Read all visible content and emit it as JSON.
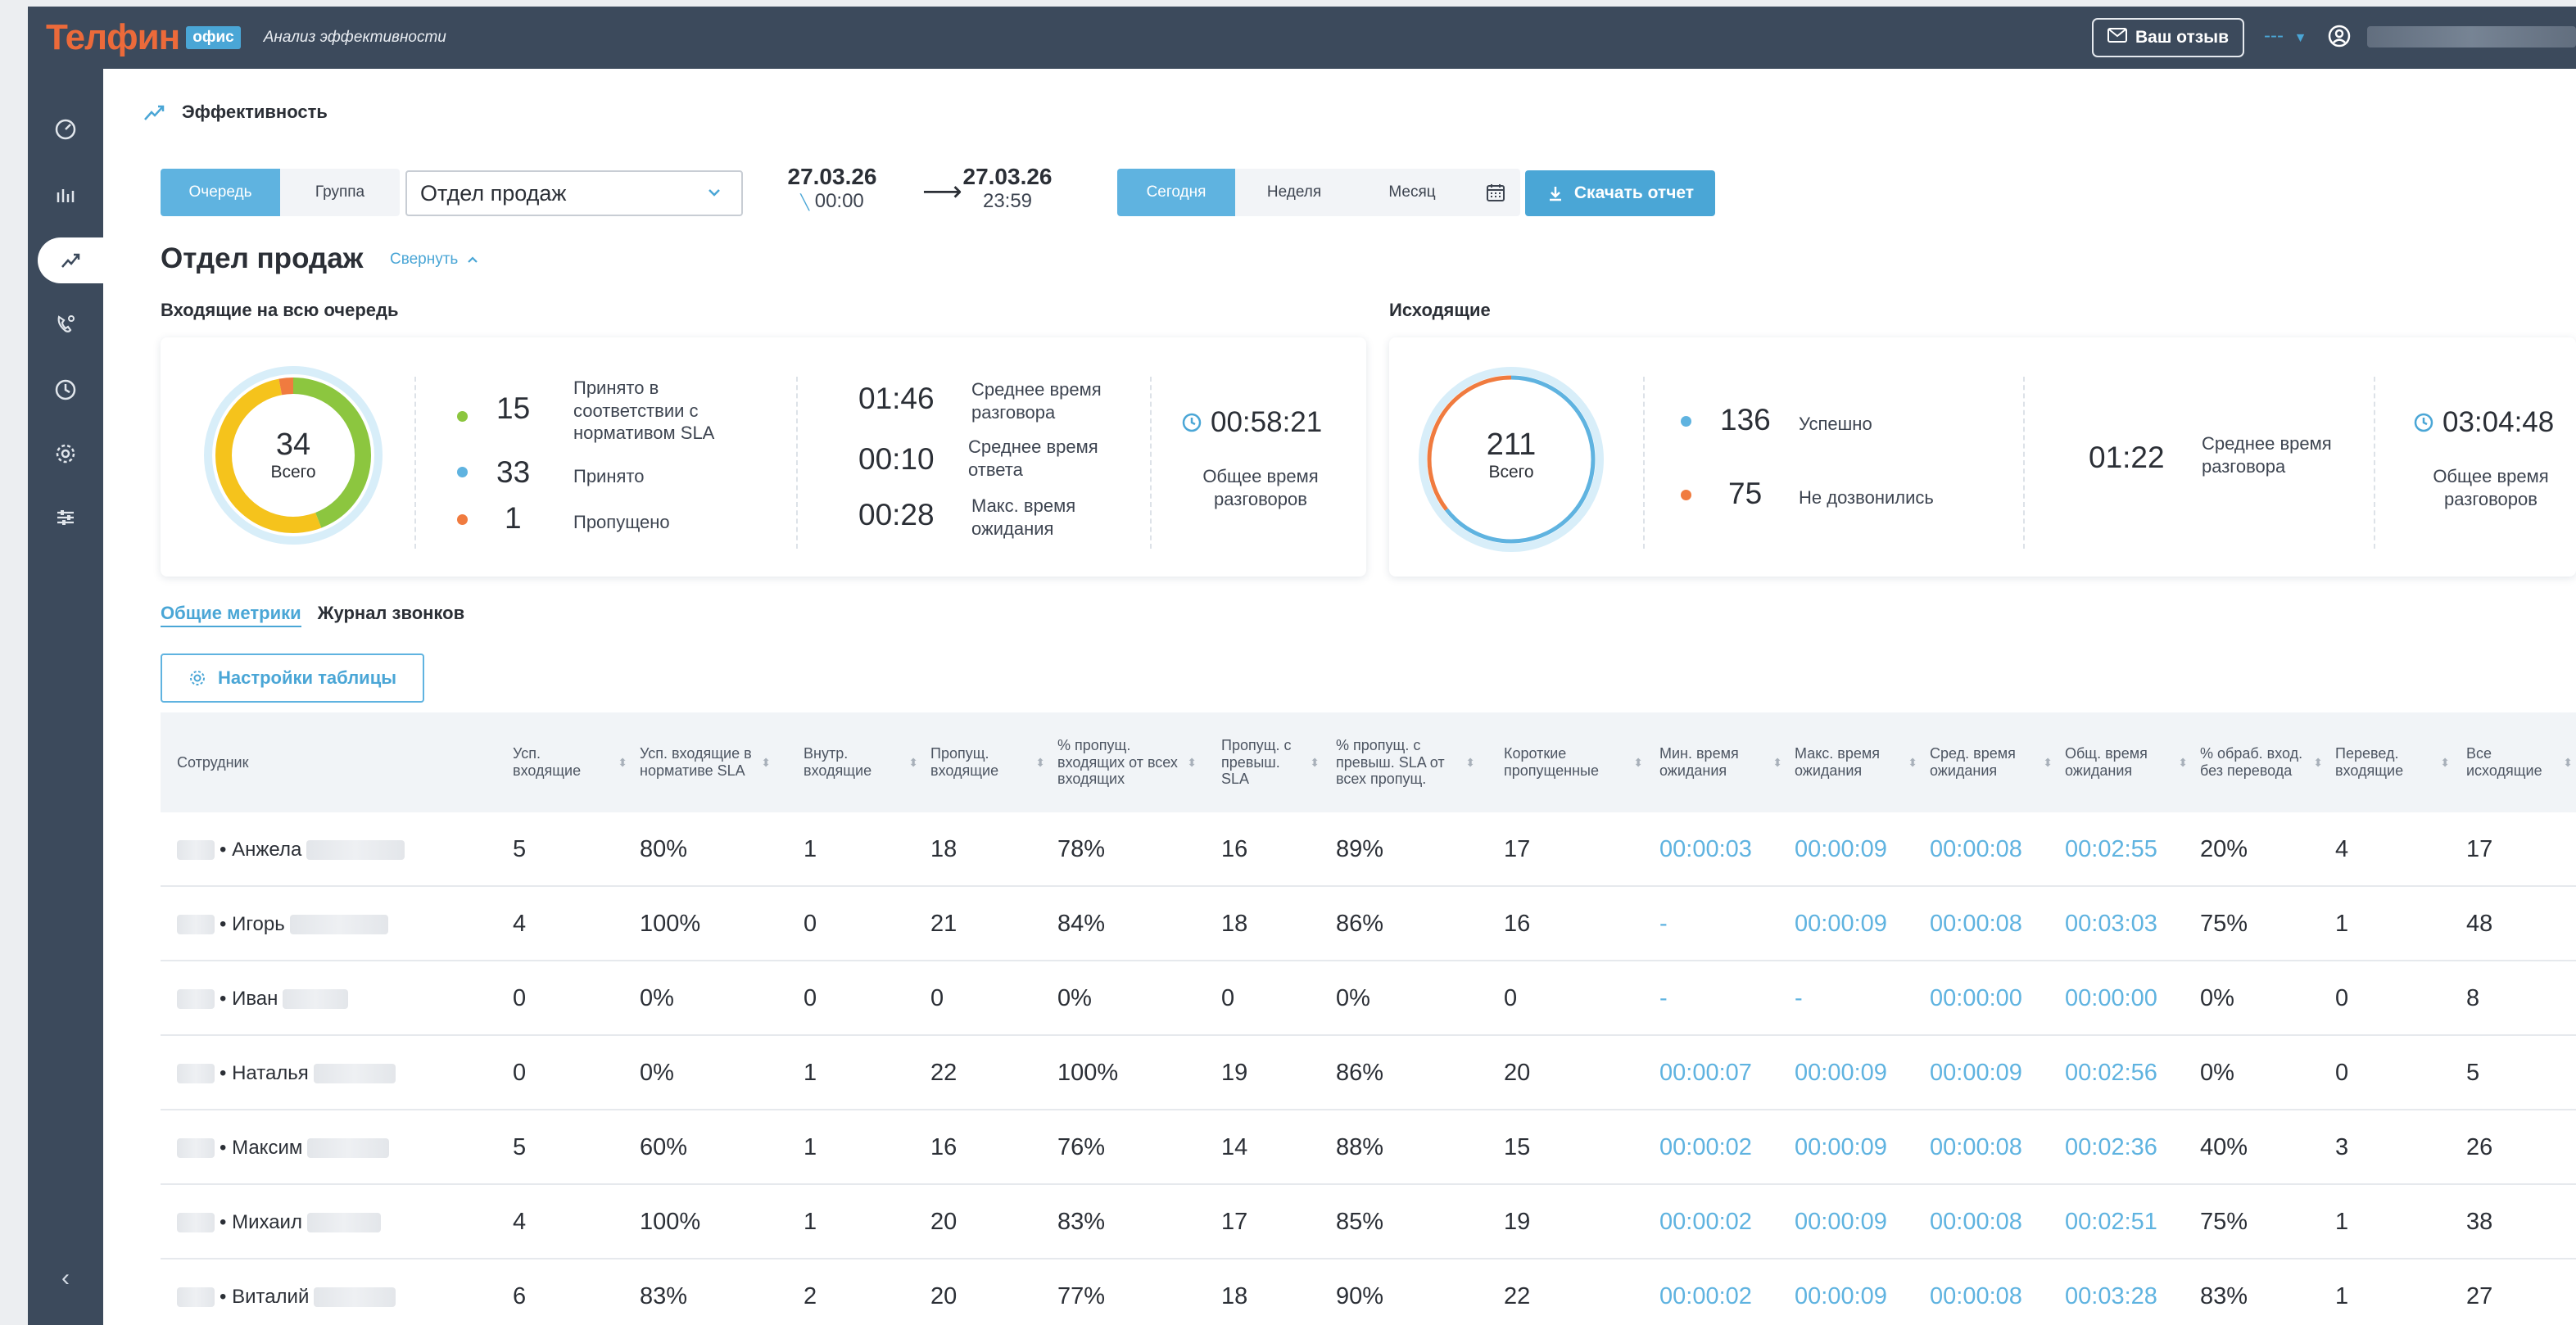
{
  "header": {
    "logo_main": "Телфин",
    "logo_badge": "офис",
    "subtitle": "Анализ эффективности",
    "feedback_label": "Ваш отзыв",
    "account_dash": "---"
  },
  "sidebar": {
    "items": [
      {
        "icon": "dashboard-gauge-icon"
      },
      {
        "icon": "bar-chart-icon"
      },
      {
        "icon": "trend-icon",
        "active": true
      },
      {
        "icon": "phone-settings-icon"
      },
      {
        "icon": "clock-icon"
      },
      {
        "icon": "gear-icon"
      },
      {
        "icon": "sliders-icon"
      }
    ],
    "collapse_glyph": "‹"
  },
  "section": {
    "title": "Эффективность"
  },
  "filters": {
    "mode_tabs": [
      {
        "label": "Очередь",
        "active": true
      },
      {
        "label": "Группа",
        "active": false
      }
    ],
    "department": "Отдел продаж",
    "date_from": "27.03.26",
    "time_from": "00:00",
    "date_to": "27.03.26",
    "time_to": "23:59",
    "period_tabs": [
      {
        "label": "Сегодня",
        "active": true
      },
      {
        "label": "Неделя",
        "active": false
      },
      {
        "label": "Месяц",
        "active": false
      }
    ],
    "download_label": "Скачать отчет"
  },
  "page": {
    "title": "Отдел продаж",
    "collapse_label": "Свернуть"
  },
  "incoming": {
    "label": "Входящие на всю очередь",
    "total": "34",
    "total_label": "Всего",
    "donut_fraction": {
      "sla": 0.441,
      "accepted_other": 0.529,
      "missed": 0.03
    },
    "stats": [
      {
        "value": "15",
        "label": "Принято в соответствии с нормативом SLA",
        "color": "#8cc63f"
      },
      {
        "value": "33",
        "label": "Принято",
        "color": "#5fb3e0"
      },
      {
        "value": "1",
        "label": "Пропущено",
        "color": "#f07b3f"
      }
    ],
    "times": [
      {
        "value": "01:46",
        "label": "Среднее время разговора"
      },
      {
        "value": "00:10",
        "label": "Среднее время ответа"
      },
      {
        "value": "00:28",
        "label": "Макс. время ожидания"
      }
    ],
    "total_talk": "00:58:21",
    "total_talk_label": "Общее время разговоров"
  },
  "outgoing": {
    "label": "Исходящие",
    "total": "211",
    "total_label": "Всего",
    "donut_fraction": {
      "success": 0.645,
      "failed": 0.355
    },
    "stats": [
      {
        "value": "136",
        "label": "Успешно",
        "color": "#5fb3e0"
      },
      {
        "value": "75",
        "label": "Не дозвонились",
        "color": "#f07b3f"
      }
    ],
    "avg_talk": "01:22",
    "avg_talk_label": "Среднее время разговора",
    "total_talk": "03:04:48",
    "total_talk_label": "Общее время разговоров"
  },
  "tabs": [
    {
      "label": "Общие метрики",
      "active": true
    },
    {
      "label": "Журнал звонков",
      "active": false
    }
  ],
  "table_settings_label": "Настройки таблицы",
  "table": {
    "columns": [
      "Сотрудник",
      "Усп. входящие",
      "Усп. входящие в нормативе SLA",
      "Внутр. входящие",
      "Пропущ. входящие",
      "% пропущ. входящих от всех входящих",
      "Пропущ. с превыш. SLA",
      "% пропущ. с превыш. SLA от всех пропущ.",
      "Короткие пропущенные",
      "Мин. время ожидания",
      "Макс. время ожидания",
      "Сред. время ожидания",
      "Общ. время ожидания",
      "% обраб. вход. без перевода",
      "Перевед. входящие",
      "Все исходящие"
    ],
    "rows": [
      {
        "name": "• Анжела",
        "cells": [
          "5",
          "80%",
          "1",
          "18",
          "78%",
          "16",
          "89%",
          "17",
          "00:00:03",
          "00:00:09",
          "00:00:08",
          "00:02:55",
          "20%",
          "4",
          "17"
        ]
      },
      {
        "name": "• Игорь",
        "cells": [
          "4",
          "100%",
          "0",
          "21",
          "84%",
          "18",
          "86%",
          "16",
          "-",
          "00:00:09",
          "00:00:08",
          "00:03:03",
          "75%",
          "1",
          "48"
        ]
      },
      {
        "name": "• Иван",
        "cells": [
          "0",
          "0%",
          "0",
          "0",
          "0%",
          "0",
          "0%",
          "0",
          "-",
          "-",
          "00:00:00",
          "00:00:00",
          "0%",
          "0",
          "8"
        ]
      },
      {
        "name": "• Наталья",
        "cells": [
          "0",
          "0%",
          "1",
          "22",
          "100%",
          "19",
          "86%",
          "20",
          "00:00:07",
          "00:00:09",
          "00:00:09",
          "00:02:56",
          "0%",
          "0",
          "5"
        ]
      },
      {
        "name": "• Максим",
        "cells": [
          "5",
          "60%",
          "1",
          "16",
          "76%",
          "14",
          "88%",
          "15",
          "00:00:02",
          "00:00:09",
          "00:00:08",
          "00:02:36",
          "40%",
          "3",
          "26"
        ]
      },
      {
        "name": "• Михаил",
        "cells": [
          "4",
          "100%",
          "1",
          "20",
          "83%",
          "17",
          "85%",
          "19",
          "00:00:02",
          "00:00:09",
          "00:00:08",
          "00:02:51",
          "75%",
          "1",
          "38"
        ]
      },
      {
        "name": "• Виталий",
        "cells": [
          "6",
          "83%",
          "2",
          "20",
          "77%",
          "18",
          "90%",
          "22",
          "00:00:02",
          "00:00:09",
          "00:00:08",
          "00:03:28",
          "83%",
          "1",
          "27"
        ]
      }
    ]
  },
  "colors": {
    "topbar": "#3c4a5c",
    "accent": "#4aa6d6",
    "brand_orange": "#ec6a3a",
    "green": "#8cc63f",
    "yellow": "#f5c31c",
    "orange": "#f07b3f"
  }
}
